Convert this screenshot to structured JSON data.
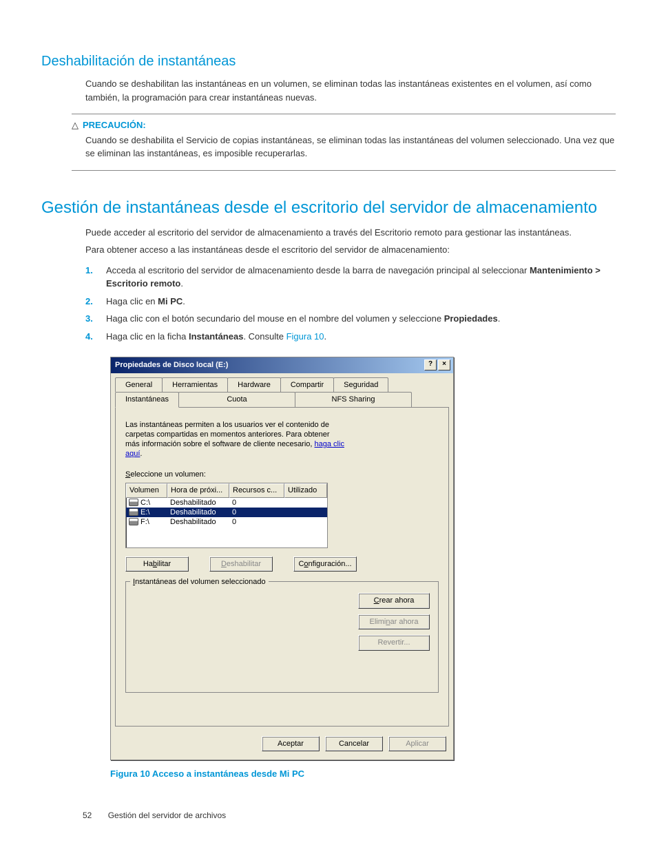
{
  "section1": {
    "heading": "Deshabilitación de instantáneas",
    "para": "Cuando se deshabilitan las instantáneas en un volumen, se eliminan todas las instantáneas existentes en el volumen, así como también, la programación para crear instantáneas nuevas."
  },
  "caution": {
    "label": "PRECAUCIÓN:",
    "text": "Cuando se deshabilita el Servicio de copias instantáneas, se eliminan todas las instantáneas del volumen seleccionado. Una vez que se eliminan las instantáneas, es imposible recuperarlas."
  },
  "section2": {
    "heading": "Gestión de instantáneas desde el escritorio del servidor de almacenamiento",
    "para1": "Puede acceder al escritorio del servidor de almacenamiento a través del Escritorio remoto para gestionar las instantáneas.",
    "para2": "Para obtener acceso a las instantáneas desde el escritorio del servidor de almacenamiento:",
    "steps": [
      {
        "n": "1.",
        "pre": "Acceda al escritorio del servidor de almacenamiento desde la barra de navegación principal al seleccionar ",
        "bold": "Mantenimiento > Escritorio remoto",
        "post": "."
      },
      {
        "n": "2.",
        "pre": "Haga clic en ",
        "bold": "Mi PC",
        "post": "."
      },
      {
        "n": "3.",
        "pre": "Haga clic con el botón secundario del mouse en el nombre del volumen y seleccione ",
        "bold": "Propiedades",
        "post": "."
      },
      {
        "n": "4.",
        "pre": "Haga clic en la ficha ",
        "bold": "Instantáneas",
        "post": ". Consulte ",
        "link": "Figura 10",
        "post2": "."
      }
    ]
  },
  "dialog": {
    "title": "Propiedades de Disco local (E:)",
    "help": "?",
    "close": "×",
    "tabs_row1": [
      "General",
      "Herramientas",
      "Hardware",
      "Compartir",
      "Seguridad"
    ],
    "tabs_row2": [
      "Instantáneas",
      "Cuota",
      "NFS Sharing"
    ],
    "active_tab": "Instantáneas",
    "desc": "Las instantáneas permiten a los usuarios ver el contenido de carpetas compartidas en momentos anteriores. Para obtener más información sobre el software de cliente necesario, ",
    "desc_link": "haga clic aquí",
    "desc_post": ".",
    "select_label_pre": "S",
    "select_label": "eleccione un volumen:",
    "columns": [
      "Volumen",
      "Hora de próxi...",
      "Recursos c...",
      "Utilizado"
    ],
    "rows": [
      {
        "vol": "C:\\",
        "hora": "Deshabilitado",
        "rec": "0",
        "util": "",
        "sel": false
      },
      {
        "vol": "E:\\",
        "hora": "Deshabilitado",
        "rec": "0",
        "util": "",
        "sel": true
      },
      {
        "vol": "F:\\",
        "hora": "Deshabilitado",
        "rec": "0",
        "util": "",
        "sel": false
      }
    ],
    "btn_enable": "Habilitar",
    "btn_disable": "Deshabilitar",
    "btn_config": "Configuración...",
    "groupbox_title": "Instantáneas del volumen seleccionado",
    "btn_create": "Crear ahora",
    "btn_delete": "Eliminar ahora",
    "btn_revert": "Revertir...",
    "btn_ok": "Aceptar",
    "btn_cancel": "Cancelar",
    "btn_apply": "Aplicar"
  },
  "figure_caption": "Figura 10 Acceso a instantáneas desde Mi PC",
  "footer": {
    "page": "52",
    "chapter": "Gestión del servidor de archivos"
  }
}
